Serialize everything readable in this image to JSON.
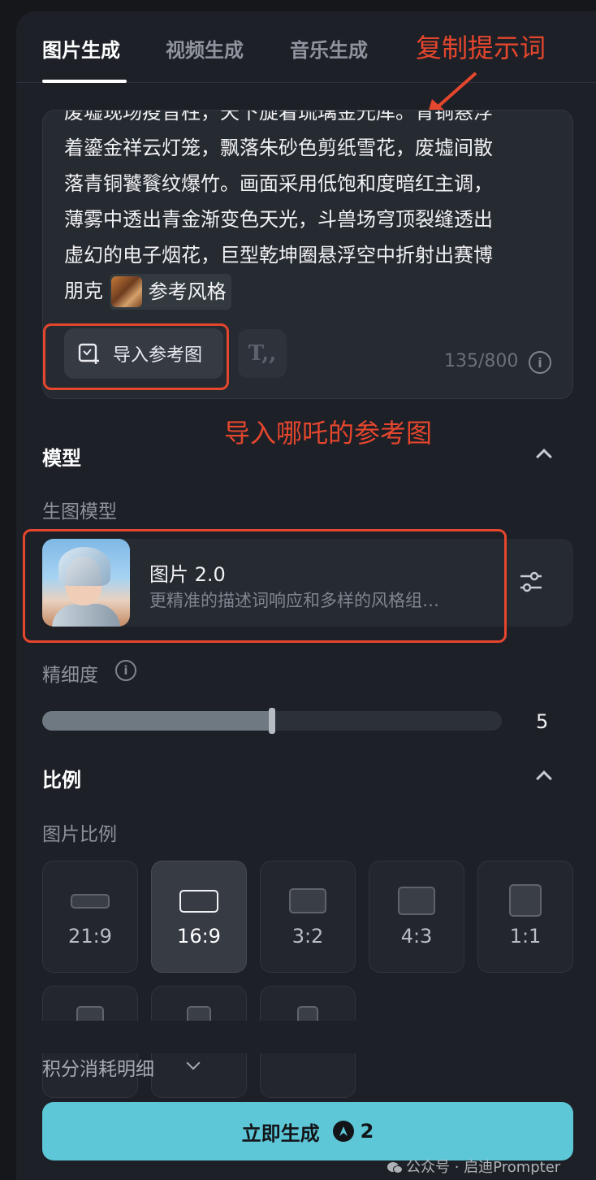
{
  "tabs": [
    {
      "label": "图片生成",
      "active": true
    },
    {
      "label": "视频生成",
      "active": false
    },
    {
      "label": "音乐生成",
      "active": false
    }
  ],
  "annotations": {
    "copy_prompt": "复制提示词",
    "import_ref": "导入哪吒的参考图"
  },
  "prompt": {
    "line0": "废墟现场疫音柱，天下旋着琉璃金光库。青铜悬浮",
    "line1": "着鎏金祥云灯笼，飘落朱砂色剪纸雪花，废墟间散",
    "line2": "落青铜饕餮纹爆竹。画面采用低饱和度暗红主调，",
    "line3": "薄雾中透出青金渐变色天光，斗兽场穹顶裂缝透出",
    "line4": "虚幻的电子烟花，巨型乾坤圈悬浮空中折射出赛博",
    "line5_prefix": "朋克",
    "style_chip": "参考风格",
    "import_button": "导入参考图",
    "counter": "135/800"
  },
  "model_section": {
    "title": "模型",
    "subtitle": "生图模型",
    "model_name": "图片 2.0",
    "model_desc": "更精准的描述词响应和多样的风格组…"
  },
  "detail": {
    "label": "精细度",
    "value": "5",
    "fraction": 0.5
  },
  "ratio_section": {
    "title": "比例",
    "subtitle": "图片比例",
    "options": [
      "21:9",
      "16:9",
      "3:2",
      "4:3",
      "1:1"
    ],
    "selected": "16:9"
  },
  "cost_label": "积分消耗明细",
  "generate": {
    "label": "立即生成",
    "cost": "2"
  },
  "watermark": "公众号 · 启迪Prompter",
  "colors": {
    "accent": "#5dc7d7",
    "annotation": "#e5462e",
    "panel": "#1d2026"
  }
}
